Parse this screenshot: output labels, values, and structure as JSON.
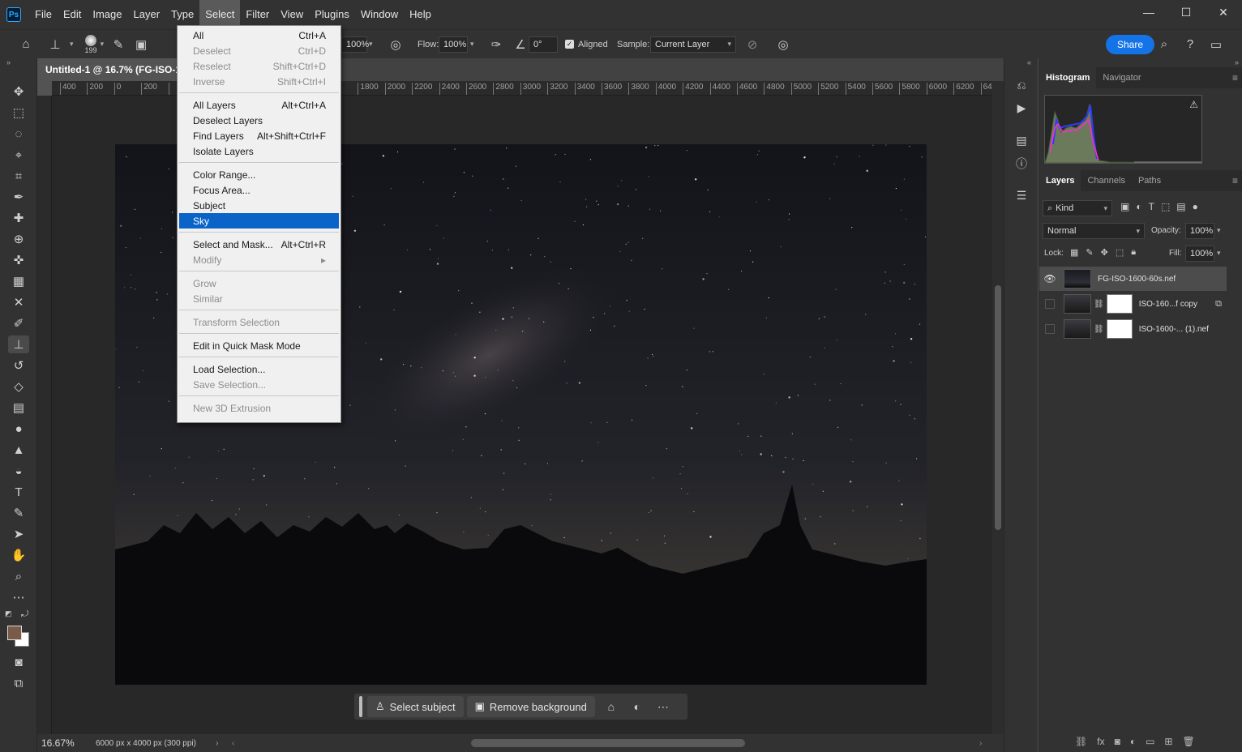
{
  "app": {
    "logo": "Ps"
  },
  "menubar": {
    "items": [
      "File",
      "Edit",
      "Image",
      "Layer",
      "Type",
      "Select",
      "Filter",
      "View",
      "Plugins",
      "Window",
      "Help"
    ],
    "active": "Select"
  },
  "window_controls": {
    "minimize": "—",
    "maximize": "☐",
    "close": "✕"
  },
  "options_bar": {
    "brush_size": "199",
    "opacity_value": "100%",
    "flow_label": "Flow:",
    "flow_value": "100%",
    "angle_value": "0°",
    "aligned_label": "Aligned",
    "aligned_checked": true,
    "sample_label": "Sample:",
    "sample_value": "Current Layer",
    "share_label": "Share"
  },
  "document": {
    "tab_title": "Untitled-1 @ 16.7% (FG-ISO-16",
    "zoom": "16.67%",
    "info": "6000 px x 4000 px (300 ppi)"
  },
  "ruler": {
    "ticks": [
      "400",
      "200",
      "0",
      "200",
      "",
      "",
      "",
      "",
      "",
      "",
      "",
      "1800",
      "2000",
      "2200",
      "2400",
      "2600",
      "2800",
      "3000",
      "3200",
      "3400",
      "3600",
      "3800",
      "4000",
      "4200",
      "4400",
      "4600",
      "4800",
      "5000",
      "5200",
      "5400",
      "5600",
      "5800",
      "6000",
      "6200",
      "64"
    ]
  },
  "select_menu": {
    "items": [
      {
        "label": "All",
        "shortcut": "Ctrl+A",
        "enabled": true
      },
      {
        "label": "Deselect",
        "shortcut": "Ctrl+D",
        "enabled": false
      },
      {
        "label": "Reselect",
        "shortcut": "Shift+Ctrl+D",
        "enabled": false
      },
      {
        "label": "Inverse",
        "shortcut": "Shift+Ctrl+I",
        "enabled": false
      },
      {
        "label": "All Layers",
        "shortcut": "Alt+Ctrl+A",
        "enabled": true
      },
      {
        "label": "Deselect Layers",
        "shortcut": "",
        "enabled": true
      },
      {
        "label": "Find Layers",
        "shortcut": "Alt+Shift+Ctrl+F",
        "enabled": true
      },
      {
        "label": "Isolate Layers",
        "shortcut": "",
        "enabled": true
      },
      {
        "label": "Color Range...",
        "shortcut": "",
        "enabled": true
      },
      {
        "label": "Focus Area...",
        "shortcut": "",
        "enabled": true
      },
      {
        "label": "Subject",
        "shortcut": "",
        "enabled": true
      },
      {
        "label": "Sky",
        "shortcut": "",
        "enabled": true,
        "highlighted": true
      },
      {
        "label": "Select and Mask...",
        "shortcut": "Alt+Ctrl+R",
        "enabled": true
      },
      {
        "label": "Modify",
        "shortcut": "▸",
        "enabled": false
      },
      {
        "label": "Grow",
        "shortcut": "",
        "enabled": false
      },
      {
        "label": "Similar",
        "shortcut": "",
        "enabled": false
      },
      {
        "label": "Transform Selection",
        "shortcut": "",
        "enabled": false
      },
      {
        "label": "Edit in Quick Mask Mode",
        "shortcut": "",
        "enabled": true
      },
      {
        "label": "Load Selection...",
        "shortcut": "",
        "enabled": true
      },
      {
        "label": "Save Selection...",
        "shortcut": "",
        "enabled": false
      },
      {
        "label": "New 3D Extrusion",
        "shortcut": "",
        "enabled": false
      }
    ]
  },
  "context_bar": {
    "select_subject": "Select subject",
    "remove_background": "Remove background"
  },
  "panels": {
    "top_tabs": [
      "Histogram",
      "Navigator"
    ],
    "layer_tabs": [
      "Layers",
      "Channels",
      "Paths"
    ],
    "filter_kind": "Kind",
    "blend_mode": "Normal",
    "opacity_label": "Opacity:",
    "opacity_value": "100%",
    "lock_label": "Lock:",
    "fill_label": "Fill:",
    "fill_value": "100%"
  },
  "layers": [
    {
      "name": "FG-ISO-1600-60s.nef",
      "visible": true,
      "selected": true
    },
    {
      "name": "ISO-160...f copy",
      "visible": false,
      "selected": false
    },
    {
      "name": "ISO-1600-... (1).nef",
      "visible": false,
      "selected": false
    }
  ],
  "colors": {
    "accent": "#1473e6",
    "menu_highlight": "#0a64c8",
    "foreground_swatch": "#7a5a48",
    "background_swatch": "#ffffff"
  }
}
